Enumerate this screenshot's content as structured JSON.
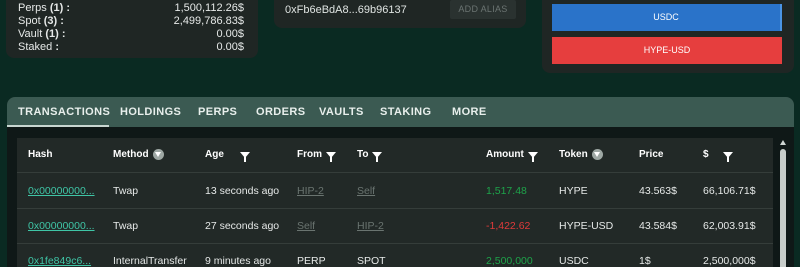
{
  "summary": {
    "rows": [
      {
        "label": "Perps",
        "count": "(1)",
        "sep": ":",
        "value": "1,500,112.26$"
      },
      {
        "label": "Spot",
        "count": "(3)",
        "sep": ":",
        "value": "2,499,786.83$"
      },
      {
        "label": "Vault",
        "count": "(1)",
        "sep": ":",
        "value": "0.00$"
      },
      {
        "label": "Staked",
        "count": "",
        "sep": ":",
        "value": "0.00$"
      }
    ]
  },
  "address": {
    "text": "0xFb6eBdA8...69b96137",
    "alias_label": "ADD ALIAS"
  },
  "tokens": {
    "usdc": "USDC",
    "hype": "HYPE-USD"
  },
  "tabs": [
    "TRANSACTIONS",
    "HOLDINGS",
    "PERPS",
    "ORDERS",
    "VAULTS",
    "STAKING",
    "MORE"
  ],
  "table": {
    "headers": [
      "Hash",
      "Method",
      "Age",
      "From",
      "To",
      "Amount",
      "Token",
      "Price",
      "$"
    ],
    "rows": [
      {
        "hash": "0x00000000...",
        "method": "Twap",
        "age": "13 seconds ago",
        "from": "HIP-2",
        "to": "Self",
        "amount": "1,517.48",
        "token": "HYPE",
        "price": "43.563$",
        "usd": "66,106.71$"
      },
      {
        "hash": "0x00000000...",
        "method": "Twap",
        "age": "27 seconds ago",
        "from": "Self",
        "to": "HIP-2",
        "amount": "-1,422.62",
        "token": "HYPE-USD",
        "price": "43.584$",
        "usd": "62,003.91$"
      },
      {
        "hash": "0x1fe849c6...",
        "method": "InternalTransfer",
        "age": "9 minutes ago",
        "from": "PERP",
        "to": "SPOT",
        "amount": "2,500,000",
        "token": "USDC",
        "price": "1$",
        "usd": "2,500,000$"
      }
    ]
  },
  "colors": {
    "background": "#0a2a22",
    "tab_bar": "#3b5a52",
    "link": "#3fc5a6",
    "positive": "#1ea34a",
    "negative": "#e03a3a",
    "usdc_bar": "#2a73c9",
    "hype_bar": "#e63e3e"
  }
}
